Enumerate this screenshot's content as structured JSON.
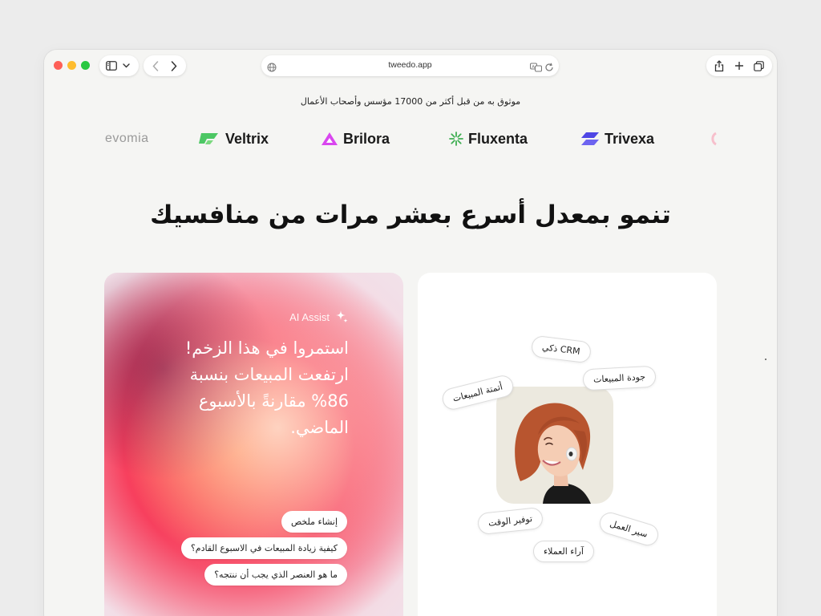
{
  "browser": {
    "url": "tweedo.app",
    "icons": {
      "sidebar": "sidebar-icon",
      "dropdown": "chevron-down-icon",
      "back": "chevron-left-icon",
      "forward": "chevron-right-icon",
      "site": "globe-icon",
      "translate": "translate-icon",
      "reload": "reload-icon",
      "share": "share-icon",
      "new_tab": "plus-icon",
      "tabs": "tabs-overview-icon"
    }
  },
  "trusted": {
    "text": "موثوق به من قبل أكثر من 17000 مؤسس وأصحاب الأعمال"
  },
  "logos": [
    {
      "name": "evomia"
    },
    {
      "name": "Veltrix",
      "color": "#4cc764"
    },
    {
      "name": "Brilora",
      "color": "#d946ef"
    },
    {
      "name": "Fluxenta",
      "color": "#3fae52"
    },
    {
      "name": "Trivexa",
      "color": "#4f46e5"
    }
  ],
  "headline": "تنمو بمعدل أسرع بعشر مرات من منافسيك",
  "ai_card": {
    "label": "AI Assist",
    "icon": "sparkle-icon",
    "message": "استمروا في هذا الزخم! ارتفعت المبيعات بنسبة 86% مقارنةً بالأسبوع الماضي.",
    "suggestions": [
      "إنشاء ملخص",
      "كيفية زيادة المبيعات في الاسبوع القادم؟",
      "ما هو العنصر الذي يجب أن ننتجه؟"
    ]
  },
  "crm_card": {
    "tags": [
      "CRM ذكي",
      "جودة المبيعات",
      "أتمتة المبيعات",
      "توفير الوقت",
      "سير العمل",
      "آراء العملاء"
    ]
  }
}
